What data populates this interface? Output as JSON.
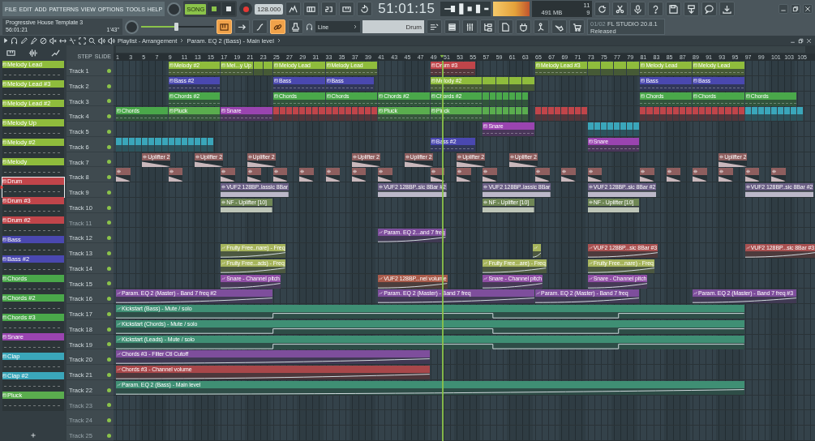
{
  "menu": [
    "FILE",
    "EDIT",
    "ADD",
    "PATTERNS",
    "VIEW",
    "OPTIONS",
    "TOOLS",
    "HELP"
  ],
  "project": {
    "title": "Progressive House Template 3",
    "position": "56:01:21",
    "length": "1'43\""
  },
  "transport": {
    "mode": "SONG",
    "tempo": "128.000",
    "time": "51:01:15"
  },
  "monitor": {
    "cpu": "11",
    "memory": "491 MB",
    "polyphony": "9"
  },
  "pitch": {
    "level": 0.48
  },
  "tools": [
    {
      "on": true
    },
    {
      "on": false
    },
    {
      "on": false
    },
    {
      "on": true
    },
    {
      "on": false
    }
  ],
  "snap": "Line",
  "pattern": "Drum",
  "hint": {
    "counter": "01/02",
    "title": "FL STUDIO 20.8.1",
    "text": "Released"
  },
  "breadcrumb": [
    "Playlist - Arrangement",
    "Param. EQ 2 (Bass) - Main level"
  ],
  "playlist_options": [
    "STEP",
    "SLIDE"
  ],
  "picker": [
    {
      "name": "Melody Lead",
      "color": "#8fbc3c",
      "selected": false
    },
    {
      "name": "Melody Lead #3",
      "color": "#8fbc3c",
      "selected": false
    },
    {
      "name": "Melody Lead #2",
      "color": "#8fbc3c",
      "selected": false
    },
    {
      "name": "Melody Up",
      "color": "#8fbc3c",
      "selected": false
    },
    {
      "name": "Melody #2",
      "color": "#8fbc3c",
      "selected": false
    },
    {
      "name": "Melody",
      "color": "#8fbc3c",
      "selected": false
    },
    {
      "name": "Drum",
      "color": "#c0454a",
      "selected": true
    },
    {
      "name": "Drum #3",
      "color": "#c0454a",
      "selected": false
    },
    {
      "name": "Drum #2",
      "color": "#c0454a",
      "selected": false
    },
    {
      "name": "Bass",
      "color": "#4a48b0",
      "selected": false
    },
    {
      "name": "Bass #2",
      "color": "#4a48b0",
      "selected": false
    },
    {
      "name": "Chords",
      "color": "#4aa84a",
      "selected": false
    },
    {
      "name": "Chords #2",
      "color": "#4aa84a",
      "selected": false
    },
    {
      "name": "Chords #3",
      "color": "#4aa84a",
      "selected": false
    },
    {
      "name": "Snare",
      "color": "#9a44b0",
      "selected": false
    },
    {
      "name": "Clap",
      "color": "#3aa6ba",
      "selected": false
    },
    {
      "name": "Clap #2",
      "color": "#3aa6ba",
      "selected": false
    },
    {
      "name": "Pluck",
      "color": "#5aad4e",
      "selected": false
    }
  ],
  "ruler": [
    "1",
    "3",
    "5",
    "7",
    "9",
    "11",
    "13",
    "15",
    "17",
    "19",
    "21",
    "23",
    "25",
    "27",
    "29",
    "31",
    "33",
    "35",
    "37",
    "39",
    "41",
    "43",
    "45",
    "47",
    "49",
    "51",
    "53",
    "55",
    "57",
    "59",
    "61",
    "63",
    "65",
    "67",
    "69",
    "71",
    "73",
    "75",
    "77",
    "79",
    "81",
    "83",
    "85",
    "87",
    "89",
    "91",
    "93",
    "95",
    "97",
    "99",
    "101",
    "103",
    "105"
  ],
  "tracks": [
    {
      "name": "Track 1",
      "dimmed": false,
      "clips": [
        {
          "kind": "pattern",
          "label": "Melody #2",
          "color": "#8fbc3c"
        },
        {
          "kind": "pattern",
          "label": "Mel...y Up",
          "color": "#8fbc3c"
        },
        {
          "kind": "tiles",
          "color": "#8fbc3c"
        },
        {
          "kind": "pattern",
          "label": "Melody Lead",
          "color": "#8fbc3c"
        },
        {
          "kind": "pattern",
          "label": "Melody Lead",
          "color": "#8fbc3c"
        },
        {
          "kind": "pattern",
          "label": "Drum #3",
          "color": "#c0454a"
        },
        {
          "kind": "pattern",
          "label": "Melody Lead #3",
          "color": "#8fbc3c"
        },
        {
          "kind": "tiles",
          "color": "#8fbc3c"
        },
        {
          "kind": "pattern",
          "label": "Melody Lead",
          "color": "#8fbc3c"
        },
        {
          "kind": "pattern",
          "label": "Melody Lead",
          "color": "#8fbc3c"
        }
      ]
    },
    {
      "name": "Track 2",
      "dimmed": false,
      "clips": [
        {
          "kind": "pattern",
          "label": "Bass #2",
          "color": "#4a48b0"
        },
        {
          "kind": "pattern",
          "label": "Bass",
          "color": "#4a48b0"
        },
        {
          "kind": "pattern",
          "label": "Bass",
          "color": "#4a48b0"
        },
        {
          "kind": "pattern",
          "label": "Melody #2",
          "color": "#8fbc3c"
        },
        {
          "kind": "tiles",
          "color": "#8fbc3c"
        },
        {
          "kind": "pattern",
          "label": "Bass",
          "color": "#4a48b0"
        },
        {
          "kind": "pattern",
          "label": "Bass",
          "color": "#4a48b0"
        }
      ]
    },
    {
      "name": "Track 3",
      "dimmed": false,
      "clips": [
        {
          "kind": "pattern",
          "label": "Chords #2",
          "color": "#4aa84a"
        },
        {
          "kind": "pattern",
          "label": "Chords",
          "color": "#4aa84a"
        },
        {
          "kind": "pattern",
          "label": "Chords",
          "color": "#4aa84a"
        },
        {
          "kind": "pattern",
          "label": "Chords #2",
          "color": "#4aa84a"
        },
        {
          "kind": "pattern",
          "label": "Chords #2",
          "color": "#4aa84a"
        },
        {
          "kind": "tiles",
          "color": "#4aa84a"
        },
        {
          "kind": "pattern",
          "label": "Chords",
          "color": "#4aa84a"
        },
        {
          "kind": "pattern",
          "label": "Chords",
          "color": "#4aa84a"
        },
        {
          "kind": "pattern",
          "label": "Chords",
          "color": "#4aa84a"
        }
      ]
    },
    {
      "name": "Track 4",
      "dimmed": false,
      "clips": [
        {
          "kind": "pattern",
          "label": "Chords",
          "color": "#4aa84a"
        },
        {
          "kind": "pattern",
          "label": "Pluck",
          "color": "#5aad4e"
        },
        {
          "kind": "pattern",
          "label": "Snare",
          "color": "#9a44b0"
        },
        {
          "kind": "tiles",
          "color": "#c0454a"
        },
        {
          "kind": "pattern",
          "label": "Pluck",
          "color": "#5aad4e"
        },
        {
          "kind": "pattern",
          "label": "Pluck",
          "color": "#5aad4e"
        },
        {
          "kind": "tiles",
          "color": "#5aad4e"
        },
        {
          "kind": "tiles",
          "color": "#c0454a"
        },
        {
          "kind": "tiles",
          "color": "#c0454a"
        },
        {
          "kind": "tiles",
          "color": "#3aa6ba"
        }
      ]
    },
    {
      "name": "Track 5",
      "dimmed": false,
      "clips": [
        {
          "kind": "pattern",
          "label": "Snare",
          "color": "#9a44b0"
        },
        {
          "kind": "tiles",
          "color": "#3aa6ba"
        }
      ]
    },
    {
      "name": "Track 6",
      "dimmed": false,
      "clips": [
        {
          "kind": "tiles",
          "color": "#3aa6ba"
        },
        {
          "kind": "pattern",
          "label": "Bass #2",
          "color": "#4a48b0"
        },
        {
          "kind": "pattern",
          "label": "Snare",
          "color": "#9a44b0"
        }
      ]
    },
    {
      "name": "Track 7",
      "dimmed": false,
      "clips": [
        {
          "kind": "audio",
          "label": "Uplifter 2",
          "color": "#8e5e5e"
        },
        {
          "kind": "audio",
          "label": "Uplifter 2",
          "color": "#8e5e5e"
        },
        {
          "kind": "audio",
          "label": "Uplifter 2",
          "color": "#8e5e5e"
        },
        {
          "kind": "audio",
          "label": "Uplifter 2",
          "color": "#8e5e5e"
        },
        {
          "kind": "audio",
          "label": "Uplifter 2",
          "color": "#8e5e5e"
        },
        {
          "kind": "audio",
          "label": "Uplifter 2",
          "color": "#8e5e5e"
        },
        {
          "kind": "audio",
          "label": "Uplifter 2",
          "color": "#8e5e5e"
        },
        {
          "kind": "audio",
          "label": "Uplifter 2",
          "color": "#8e5e5e"
        }
      ]
    },
    {
      "name": "Track 8",
      "dimmed": false,
      "clips": [
        {
          "kind": "sample",
          "color": "#8e5e5e"
        },
        {
          "kind": "sample",
          "color": "#8e5e5e"
        },
        {
          "kind": "sample",
          "color": "#8e5e5e"
        },
        {
          "kind": "sample",
          "color": "#8e5e5e"
        },
        {
          "kind": "sample",
          "color": "#8e5e5e"
        },
        {
          "kind": "sample",
          "color": "#8e5e5e"
        },
        {
          "kind": "sample",
          "color": "#8e5e5e"
        },
        {
          "kind": "sample",
          "color": "#8e5e5e"
        },
        {
          "kind": "sample",
          "color": "#8e5e5e"
        },
        {
          "kind": "sample",
          "color": "#8e5e5e"
        },
        {
          "kind": "sample",
          "color": "#8e5e5e"
        },
        {
          "kind": "sample",
          "color": "#8e5e5e"
        },
        {
          "kind": "sample",
          "color": "#8e5e5e"
        },
        {
          "kind": "sample",
          "color": "#8e5e5e"
        },
        {
          "kind": "sample",
          "color": "#8e5e5e"
        },
        {
          "kind": "sample",
          "color": "#8e5e5e"
        },
        {
          "kind": "sample",
          "color": "#8e5e5e"
        },
        {
          "kind": "sample",
          "color": "#8e5e5e"
        },
        {
          "kind": "sample",
          "color": "#8e5e5e"
        },
        {
          "kind": "sample",
          "color": "#8e5e5e"
        },
        {
          "kind": "sample",
          "color": "#8e5e5e"
        }
      ]
    },
    {
      "name": "Track 9",
      "dimmed": false,
      "clips": [
        {
          "kind": "audio",
          "label": "VUF2 128BP..lassic 8Bar",
          "color": "#6b5f85"
        },
        {
          "kind": "audio",
          "label": "VUF2 128BP..sic 8Bar #2",
          "color": "#6b5f85"
        },
        {
          "kind": "audio",
          "label": "VUF2 128BP..lassic 8Bar",
          "color": "#6b5f85"
        },
        {
          "kind": "audio",
          "label": "VUF2 128BP..sic 8Bar #2",
          "color": "#6b5f85"
        },
        {
          "kind": "audio",
          "label": "VUF2 128BP..sic 8Bar #2",
          "color": "#6b5f85"
        }
      ]
    },
    {
      "name": "Track 10",
      "dimmed": false,
      "clips": [
        {
          "kind": "audio",
          "label": "NF - Uplifter  [10]",
          "color": "#6f8755"
        },
        {
          "kind": "audio",
          "label": "NF - Uplifter  [10]",
          "color": "#6f8755"
        },
        {
          "kind": "audio",
          "label": "NF - Uplifter  [10]",
          "color": "#6f8755"
        }
      ]
    },
    {
      "name": "Track 11",
      "dimmed": true
    },
    {
      "name": "Track 12",
      "dimmed": false,
      "clips": [
        {
          "kind": "automation",
          "label": "Param. EQ 2...and 7 freq",
          "color": "#7e4e9c"
        }
      ]
    },
    {
      "name": "Track 13",
      "dimmed": false,
      "clips": [
        {
          "kind": "automation",
          "label": "Fruity Free..nare) - Freq",
          "color": "#a6b45c"
        },
        {
          "kind": "automation",
          "color": "#a6b45c"
        },
        {
          "kind": "automation",
          "label": "VUF2 128BP...sic 8Bar #3",
          "color": "#a85050"
        },
        {
          "kind": "automation",
          "label": "VUF2 128BP...sic 8Bar #3",
          "color": "#a85050"
        }
      ]
    },
    {
      "name": "Track 14",
      "dimmed": false,
      "clips": [
        {
          "kind": "automation",
          "label": "Fruity Free...ads) - Freq",
          "color": "#a6b45c"
        },
        {
          "kind": "automation",
          "label": "Fruity Free...are) - Freq",
          "color": "#a6b45c"
        },
        {
          "kind": "automation",
          "label": "Fruity Free...nare) - Freq",
          "color": "#a6b45c"
        }
      ]
    },
    {
      "name": "Track 15",
      "dimmed": false,
      "clips": [
        {
          "kind": "automation",
          "label": "Snare - Channel pitch",
          "color": "#8f4fa4"
        },
        {
          "kind": "automation",
          "label": "VUF2 128BP...nel volume",
          "color": "#a85a4a"
        },
        {
          "kind": "automation",
          "label": "Snare - Channel pitch",
          "color": "#8f4fa4"
        },
        {
          "kind": "automation",
          "label": "Snare - Channel pitch",
          "color": "#8f4fa4"
        }
      ]
    },
    {
      "name": "Track 16",
      "dimmed": false,
      "clips": [
        {
          "kind": "automation",
          "label": "Param. EQ 2 (Master) - Band 7 freq #2",
          "color": "#7e4e9c"
        },
        {
          "kind": "automation",
          "label": "Param. EQ 2 (Master) - Band 7 freq",
          "color": "#7e4e9c"
        },
        {
          "kind": "automation",
          "label": "Param. EQ 2 (Master) - Band 7 freq",
          "color": "#7e4e9c"
        },
        {
          "kind": "automation",
          "label": "Param. EQ 2 (Master) - Band 7 freq #3",
          "color": "#7e4e9c"
        }
      ]
    },
    {
      "name": "Track 17",
      "dimmed": false,
      "clips": [
        {
          "kind": "automation",
          "label": "Kickstart (Bass) - Mute / solo",
          "color": "#3f8f74"
        }
      ]
    },
    {
      "name": "Track 18",
      "dimmed": false,
      "clips": [
        {
          "kind": "automation",
          "label": "Kickstart (Chords) - Mute / solo",
          "color": "#3f8f74"
        }
      ]
    },
    {
      "name": "Track 19",
      "dimmed": false,
      "clips": [
        {
          "kind": "automation",
          "label": "Kickstart (Leads) - Mute / solo",
          "color": "#3f8f74"
        }
      ]
    },
    {
      "name": "Track 20",
      "dimmed": false,
      "clips": [
        {
          "kind": "automation",
          "label": "Chords #3 - Filter Ctl Cutoff",
          "color": "#7e4e9c"
        }
      ]
    },
    {
      "name": "Track 21",
      "dimmed": false,
      "clips": [
        {
          "kind": "automation",
          "label": "Chords #3 - Channel volume",
          "color": "#a8474a"
        }
      ]
    },
    {
      "name": "Track 22",
      "dimmed": false,
      "clips": [
        {
          "kind": "automation",
          "label": "Param. EQ 2 (Bass) - Main level",
          "color": "#3f8f74"
        }
      ]
    },
    {
      "name": "Track 23",
      "dimmed": true
    },
    {
      "name": "Track 24",
      "dimmed": true
    },
    {
      "name": "Track 25",
      "dimmed": true
    }
  ]
}
